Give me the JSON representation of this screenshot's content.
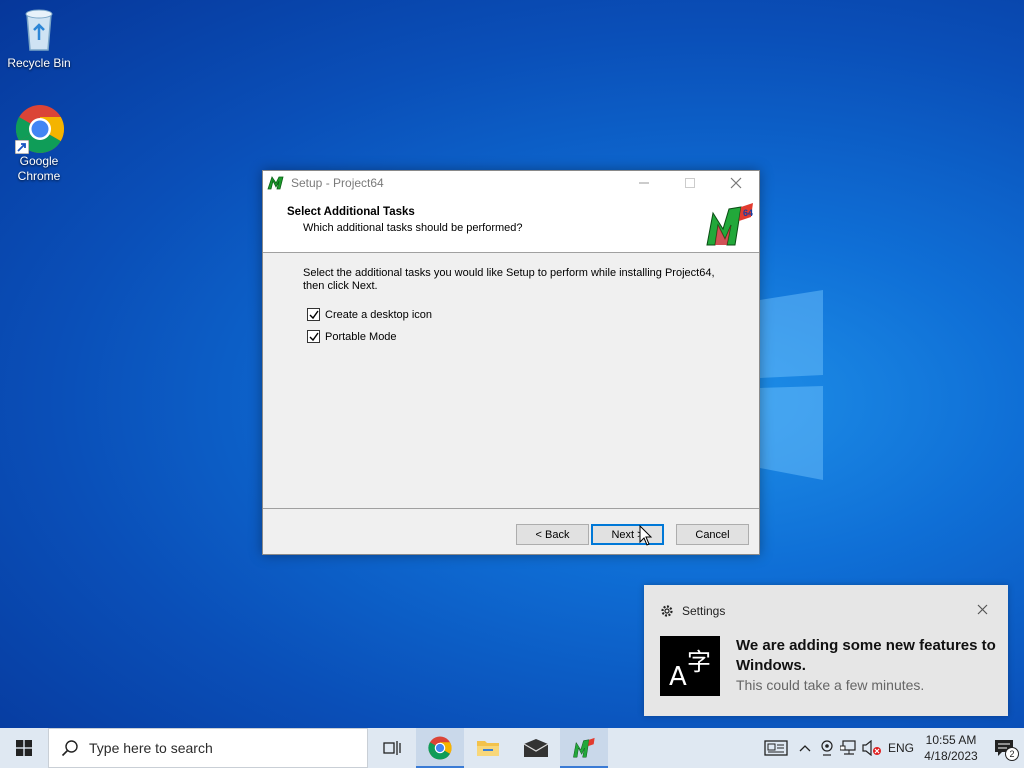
{
  "desktop": {
    "icons": [
      {
        "label": "Recycle Bin"
      },
      {
        "label": "Google Chrome"
      }
    ]
  },
  "setup": {
    "title": "Setup - Project64",
    "header_title": "Select Additional Tasks",
    "header_subtitle": "Which additional tasks should be performed?",
    "description": "Select the additional tasks you would like Setup to perform while installing Project64, then click Next.",
    "tasks": [
      {
        "label": "Create a desktop icon",
        "checked": true
      },
      {
        "label": "Portable Mode",
        "checked": true
      }
    ],
    "back_label": "< Back",
    "next_label": "Next >",
    "cancel_label": "Cancel"
  },
  "notification": {
    "app": "Settings",
    "icon_glyph_top": "字",
    "icon_glyph_bottom": "A",
    "title": "We are adding some new features to Windows.",
    "body": "This could take a few minutes."
  },
  "taskbar": {
    "search_placeholder": "Type here to search",
    "language": "ENG",
    "time": "10:55 AM",
    "date": "4/18/2023",
    "notification_count": "2",
    "accent": "#0078d7"
  }
}
